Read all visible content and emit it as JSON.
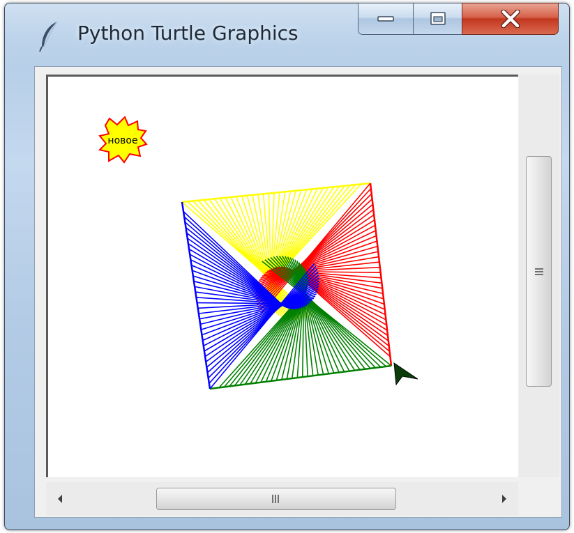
{
  "window": {
    "title": "Python Turtle Graphics",
    "icon": "feather-icon",
    "controls": [
      "minimize-icon",
      "maximize-icon",
      "close-icon"
    ]
  },
  "canvas": {
    "badge_text": "новое",
    "badge_colors": {
      "fill": "#ffff00",
      "stroke": "#ff0000"
    },
    "pen_colors": [
      "#ffff00",
      "#ff0000",
      "#008000",
      "#0000ff"
    ],
    "cursor_icon": "turtle-arrow-icon"
  },
  "scrollbars": {
    "vertical_grip_icon": "grip-icon",
    "horizontal_grip_icon": "grip-icon",
    "left_arrow_icon": "arrow-left-icon",
    "right_arrow_icon": "arrow-right-icon"
  }
}
